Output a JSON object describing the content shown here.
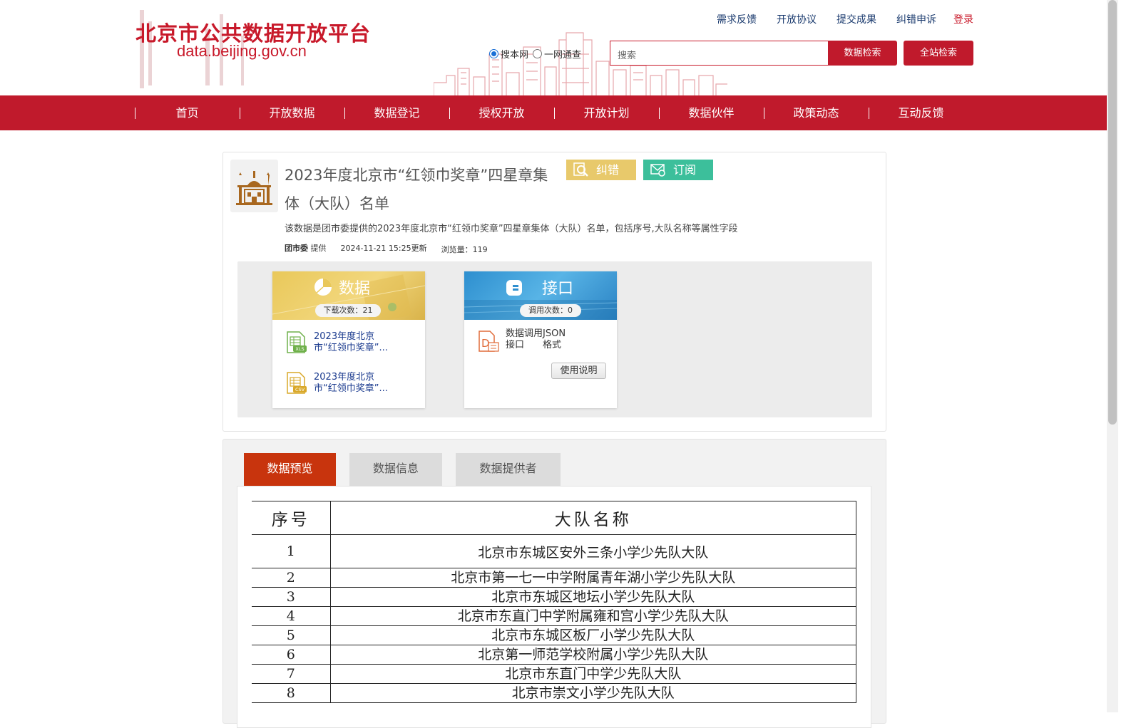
{
  "header": {
    "logo_title": "北京市公共数据开放平台",
    "logo_url": "data.beijing.gov.cn",
    "top_links": [
      "需求反馈",
      "开放协议",
      "提交成果",
      "纠错申诉"
    ],
    "login": "登录",
    "scope_options": [
      "搜本网",
      "一网通查"
    ],
    "scope_selected": "搜本网",
    "search_placeholder": "搜索",
    "search_button": "数据检索",
    "site_search_button": "全站检索"
  },
  "nav": [
    "首页",
    "开放数据",
    "数据登记",
    "授权开放",
    "开放计划",
    "数据伙伴",
    "政策动态",
    "互动反馈"
  ],
  "dataset": {
    "title": "2023年度北京市“红领巾奖章”四星章集体（大队）名单",
    "error_button": "纠错",
    "subscribe_button": "订阅",
    "description": "该数据是团市委提供的2023年度北京市“红领巾奖章”四星章集体（大队）名单，包括序号,大队名称等属性字段",
    "provider": "团市委",
    "provider_suffix": "提供",
    "updated": "2024-11-21 15:25更新",
    "views_label": "浏览量：",
    "views": "119",
    "data_card": {
      "title": "数据",
      "downloads_label": "下载次数：",
      "downloads": "21",
      "files": [
        {
          "type": "XLS",
          "name": "2023年度北京市“红领巾奖章”..."
        },
        {
          "type": "CSV",
          "name": "2023年度北京市“红领巾奖章”..."
        }
      ]
    },
    "api_card": {
      "title": "接口",
      "calls_label": "调用次数：",
      "calls": "0",
      "api_text": "数据调用接口",
      "format_text": "JSON格式",
      "usage_button": "使用说明"
    }
  },
  "tabs": [
    "数据预览",
    "数据信息",
    "数据提供者"
  ],
  "active_tab": "数据预览",
  "preview_table": {
    "headers": [
      "序号",
      "大队名称"
    ],
    "rows": [
      [
        "1",
        "北京市东城区安外三条小学少先队大队"
      ],
      [
        "2",
        "北京市第一七一中学附属青年湖小学少先队大队"
      ],
      [
        "3",
        "北京市东城区地坛小学少先队大队"
      ],
      [
        "4",
        "北京市东直门中学附属雍和宫小学少先队大队"
      ],
      [
        "5",
        "北京市东城区板厂小学少先队大队"
      ],
      [
        "6",
        "北京第一师范学校附属小学少先队大队"
      ],
      [
        "7",
        "北京市东直门中学少先队大队"
      ],
      [
        "8",
        "北京市崇文小学少先队大队"
      ]
    ]
  },
  "colors": {
    "brand_red": "#c01a2c",
    "active_tab": "#c8340d",
    "error_btn": "#e8c96b",
    "subscribe_btn": "#3cbf9b",
    "link_blue": "#1a3a8e"
  }
}
